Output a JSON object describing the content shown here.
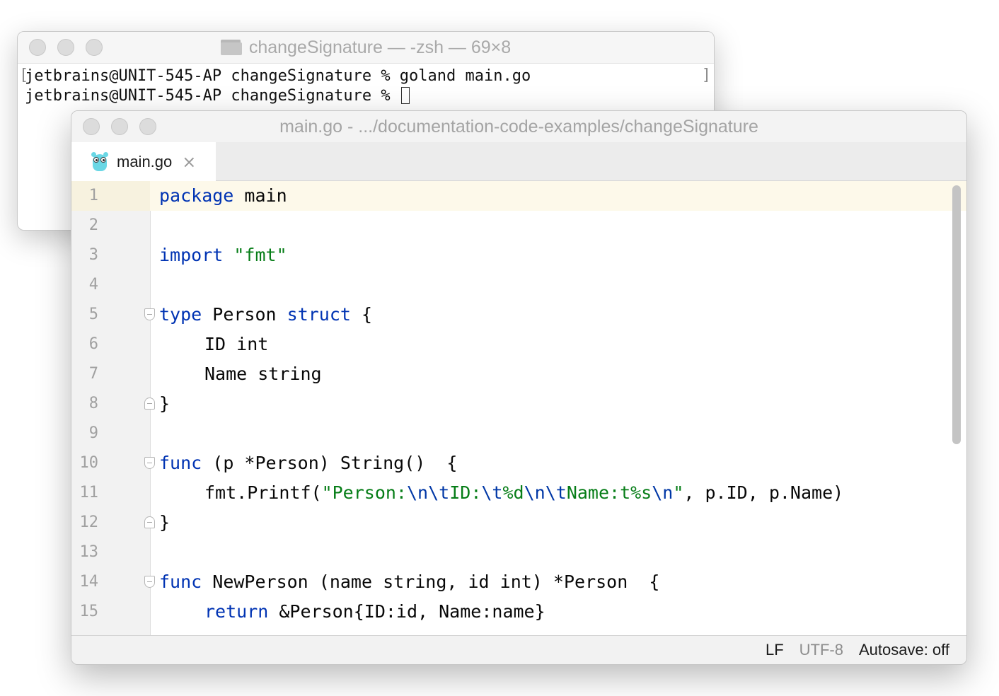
{
  "terminal": {
    "title": "changeSignature — -zsh — 69×8",
    "lines": [
      "jetbrains@UNIT-545-AP changeSignature % goland main.go",
      "jetbrains@UNIT-545-AP changeSignature % "
    ],
    "bracket_left": "[",
    "bracket_right": "]"
  },
  "editor": {
    "title": "main.go - .../documentation-code-examples/changeSignature",
    "tab": {
      "label": "main.go",
      "close_glyph": "×"
    },
    "line_numbers": [
      "1",
      "2",
      "3",
      "4",
      "5",
      "6",
      "7",
      "8",
      "9",
      "10",
      "11",
      "12",
      "13",
      "14",
      "15"
    ],
    "code": {
      "l1_kw": "package",
      "l1_rest": " main",
      "l3_kw": "import",
      "l3_str": "\"fmt\"",
      "l5_kw1": "type",
      "l5_mid": " Person ",
      "l5_kw2": "struct",
      "l5_end": " {",
      "l6": "ID int",
      "l7": "Name string",
      "l8": "}",
      "l10_kw": "func",
      "l10_rest": " (p *Person) String()  {",
      "l11_pre": "fmt.Printf(",
      "l11_s1": "\"Person:",
      "l11_e1": "\\n\\t",
      "l11_s2": "ID:",
      "l11_e2": "\\t",
      "l11_s3": "%d",
      "l11_e3": "\\n\\t",
      "l11_s4": "Name:t%s",
      "l11_e4": "\\n",
      "l11_s5": "\"",
      "l11_post": ", p.ID, p.Name)",
      "l12": "}",
      "l14_kw": "func",
      "l14_rest": " NewPerson (name string, id int) *Person  {",
      "l15_kw": "return",
      "l15_rest": " &Person{ID:id, Name:name}"
    },
    "status": {
      "line_sep": "LF",
      "encoding": "UTF-8",
      "autosave": "Autosave: off"
    }
  },
  "colors": {
    "keyword": "#0033b3",
    "string": "#067d17",
    "current_line": "#fdf9ea"
  },
  "icons": [
    "folder-icon",
    "gopher-icon",
    "close-icon",
    "fold-marker-icon"
  ]
}
